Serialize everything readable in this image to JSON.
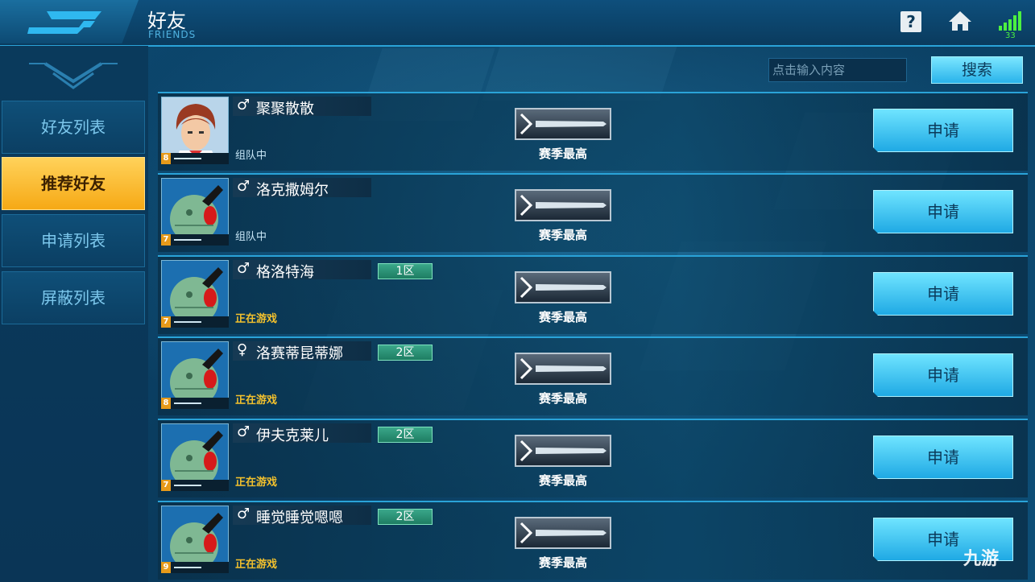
{
  "header": {
    "title_cn": "好友",
    "title_en": "FRIENDS",
    "help_label": "?",
    "ping": "33"
  },
  "sidebar": {
    "items": [
      {
        "label": "好友列表",
        "active": false
      },
      {
        "label": "推荐好友",
        "active": true
      },
      {
        "label": "申请列表",
        "active": false
      },
      {
        "label": "屏蔽列表",
        "active": false
      }
    ]
  },
  "search": {
    "placeholder": "点击输入内容",
    "button_label": "搜索"
  },
  "friends": [
    {
      "gender": "♂",
      "name": "聚聚散散",
      "server": "",
      "status": "组队中",
      "level": "8",
      "rank": "赛季最高",
      "apply": "申请",
      "avatar": "pilot-icon"
    },
    {
      "gender": "♂",
      "name": "洛克撒姆尔",
      "server": "",
      "status": "组队中",
      "level": "7",
      "rank": "赛季最高",
      "apply": "申请",
      "avatar": "haro-icon"
    },
    {
      "gender": "♂",
      "name": "格洛特海",
      "server": "1区",
      "status": "正在游戏",
      "level": "7",
      "rank": "赛季最高",
      "apply": "申请",
      "avatar": "haro-icon"
    },
    {
      "gender": "♀",
      "name": "洛赛蒂昆蒂娜",
      "server": "2区",
      "status": "正在游戏",
      "level": "8",
      "rank": "赛季最高",
      "apply": "申请",
      "avatar": "haro-icon"
    },
    {
      "gender": "♂",
      "name": "伊夫克莱儿",
      "server": "2区",
      "status": "正在游戏",
      "level": "7",
      "rank": "赛季最高",
      "apply": "申请",
      "avatar": "haro-icon"
    },
    {
      "gender": "♂",
      "name": "睡觉睡觉嗯嗯",
      "server": "2区",
      "status": "正在游戏",
      "level": "9",
      "rank": "赛季最高",
      "apply": "申请",
      "avatar": "haro-icon"
    }
  ],
  "watermark": "九游",
  "colors": {
    "accent": "#2aa3d8",
    "active_tab": "#f6a915",
    "playing_status": "#f3c12d",
    "server_badge": "#1e7d62"
  }
}
